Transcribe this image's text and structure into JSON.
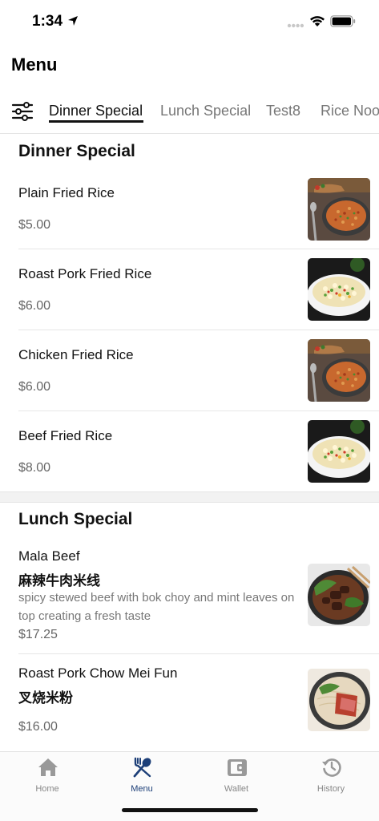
{
  "status_bar": {
    "time": "1:34"
  },
  "header": {
    "title": "Menu"
  },
  "tabs": [
    {
      "label": "Dinner Special",
      "active": true
    },
    {
      "label": "Lunch Special",
      "active": false
    },
    {
      "label": "Test8",
      "active": false
    },
    {
      "label": "Rice Noodles",
      "active": false
    }
  ],
  "sections": [
    {
      "title": "Dinner Special",
      "items": [
        {
          "name": "Plain Fried Rice",
          "price": "$5.00",
          "image": "fried-rice-photo"
        },
        {
          "name": "Roast Pork Fried Rice",
          "price": "$6.00",
          "image": "fried-rice-plate-photo"
        },
        {
          "name": "Chicken Fried Rice",
          "price": "$6.00",
          "image": "fried-rice-photo"
        },
        {
          "name": "Beef Fried Rice",
          "price": "$8.00",
          "image": "fried-rice-plate-photo"
        }
      ]
    },
    {
      "title": "Lunch Special",
      "items": [
        {
          "name": "Mala Beef",
          "name_cn": "麻辣牛肉米线",
          "description": "spicy stewed beef with bok choy and mint leaves on top creating a fresh taste",
          "price": "$17.25",
          "image": "beef-noodle-soup-photo"
        },
        {
          "name": "Roast Pork Chow Mei Fun",
          "name_cn": "叉烧米粉",
          "price": "$16.00",
          "image": "roast-pork-noodle-photo"
        }
      ]
    }
  ],
  "bottom_nav": [
    {
      "label": "Home",
      "icon": "home-icon",
      "active": false
    },
    {
      "label": "Menu",
      "icon": "fork-spoon-icon",
      "active": true
    },
    {
      "label": "Wallet",
      "icon": "wallet-icon",
      "active": false
    },
    {
      "label": "History",
      "icon": "history-icon",
      "active": false
    }
  ],
  "colors": {
    "accent": "#1d3f78",
    "text_primary": "#111111",
    "text_secondary": "#777777",
    "inactive_nav": "#888888"
  }
}
